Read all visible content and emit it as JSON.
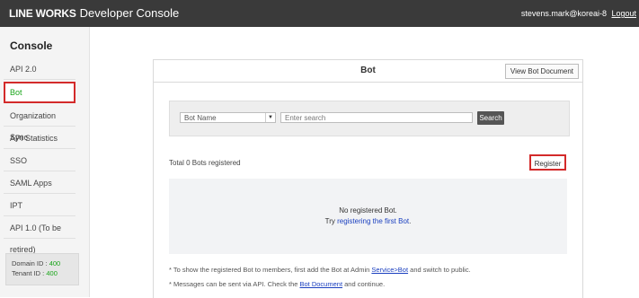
{
  "topbar": {
    "brand_bold": "LINE WORKS",
    "brand_rest": "Developer Console",
    "user": "stevens.mark@koreai-8",
    "logout": "Logout"
  },
  "sidebar": {
    "title": "Console",
    "items": [
      {
        "label": "API 2.0"
      },
      {
        "label": "Bot"
      },
      {
        "label": "Organization Sync"
      },
      {
        "label": "API Statistics"
      },
      {
        "label": "SSO"
      },
      {
        "label": "SAML Apps"
      },
      {
        "label": "IPT"
      },
      {
        "label": "API 1.0 (To be retired)"
      }
    ],
    "domain_label": "Domain ID : ",
    "domain_value": "400",
    "tenant_label": "Tenant ID : ",
    "tenant_value": "400"
  },
  "main": {
    "title": "Bot",
    "view_doc": "View Bot Document",
    "search": {
      "select_value": "Bot Name",
      "placeholder": "Enter search",
      "button": "Search"
    },
    "total_prefix": "Total ",
    "total_count": "0",
    "total_suffix": " Bots registered",
    "register": "Register",
    "empty": {
      "line1": "No registered Bot.",
      "line2_prefix": "Try ",
      "line2_link": "registering the first Bot",
      "line2_suffix": "."
    },
    "notes": {
      "n1_prefix": "* To show the registered Bot to members, first add the Bot at Admin ",
      "n1_link": "Service>Bot",
      "n1_suffix": " and switch to public.",
      "n2_prefix": "* Messages can be sent via API. Check the ",
      "n2_link": "Bot Document",
      "n2_suffix": " and continue."
    }
  },
  "colors": {
    "topbar": "#3a3a3a",
    "active_text": "#1aa51a",
    "highlight_border": "#d32a2a",
    "link": "#1a3fbf"
  }
}
